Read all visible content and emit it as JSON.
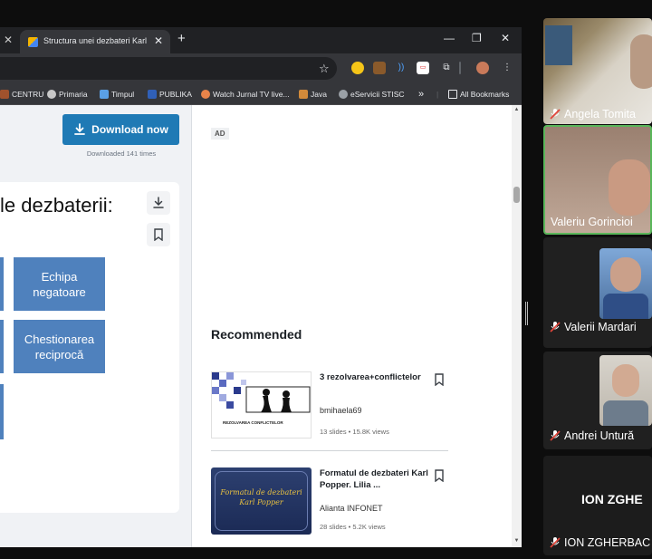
{
  "browser": {
    "tab_title": "Structura unei dezbateri Karl Po...",
    "bookmarks": [
      {
        "label": "CENTRU",
        "icon": "ruler-icon"
      },
      {
        "label": "Primaria",
        "icon": "wordpress-icon"
      },
      {
        "label": "Timpul",
        "icon": "timpul-icon"
      },
      {
        "label": "PUBLIKA",
        "icon": "publika-icon"
      },
      {
        "label": "Watch Jurnal TV live...",
        "icon": "tv-icon"
      },
      {
        "label": "Java",
        "icon": "java-icon"
      },
      {
        "label": "eServicii STISC",
        "icon": "globe-icon"
      },
      {
        "label": "»",
        "icon": "more-icon"
      },
      {
        "label": "All Bookmarks",
        "icon": "folder-icon"
      }
    ]
  },
  "left": {
    "download_label": "Download now",
    "downloaded_text": "Downloaded 141 times",
    "slide_title": "le dezbaterii:",
    "box1": "Echipa negatoare",
    "box2": "Chestionarea reciprocă"
  },
  "right": {
    "ad_label": "AD",
    "recommended_title": "Recommended",
    "items": [
      {
        "title": "3 rezolvarea+conflictelor",
        "author": "bmihaela69",
        "meta": "13 slides  •  15.8K views",
        "thumb_caption": "REZOLVAREA CONFLICTELOR"
      },
      {
        "title": "Formatul de dezbateri Karl Popper. Lilia  ...",
        "author": "Alianta INFONET",
        "meta": "28 slides  •  5.2K views",
        "thumb_caption": "Formatul de dezbateri Karl Popper"
      }
    ]
  },
  "meeting": {
    "participants": [
      {
        "name": "Angela Tomita",
        "muted": true
      },
      {
        "name": "Valeriu Gorincioi",
        "muted": false,
        "active": true
      },
      {
        "name": "Valerii Mardari",
        "muted": true
      },
      {
        "name": "Andrei Untură",
        "muted": true
      },
      {
        "name": "ION ZGHERBAC",
        "muted": true,
        "initials_text": "ION ZGHE"
      }
    ]
  },
  "colors": {
    "accent": "#1f7ab5",
    "slide_box": "#4f81bd",
    "active_speaker": "#5ab65a"
  }
}
